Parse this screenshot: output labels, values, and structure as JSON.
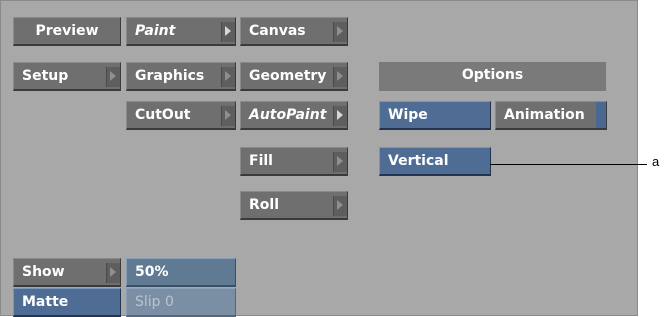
{
  "column1": {
    "preview": "Preview",
    "setup": "Setup",
    "show": "Show",
    "matte": "Matte"
  },
  "column2": {
    "paint": "Paint",
    "graphics": "Graphics",
    "cutout": "CutOut",
    "zoom": "50%",
    "slip": "Slip 0"
  },
  "column3": {
    "canvas": "Canvas",
    "geometry": "Geometry",
    "autopaint": "AutoPaint",
    "fill": "Fill",
    "roll": "Roll"
  },
  "options": {
    "header": "Options",
    "wipe": "Wipe",
    "animation": "Animation",
    "vertical": "Vertical"
  },
  "callout": {
    "label": "a"
  }
}
